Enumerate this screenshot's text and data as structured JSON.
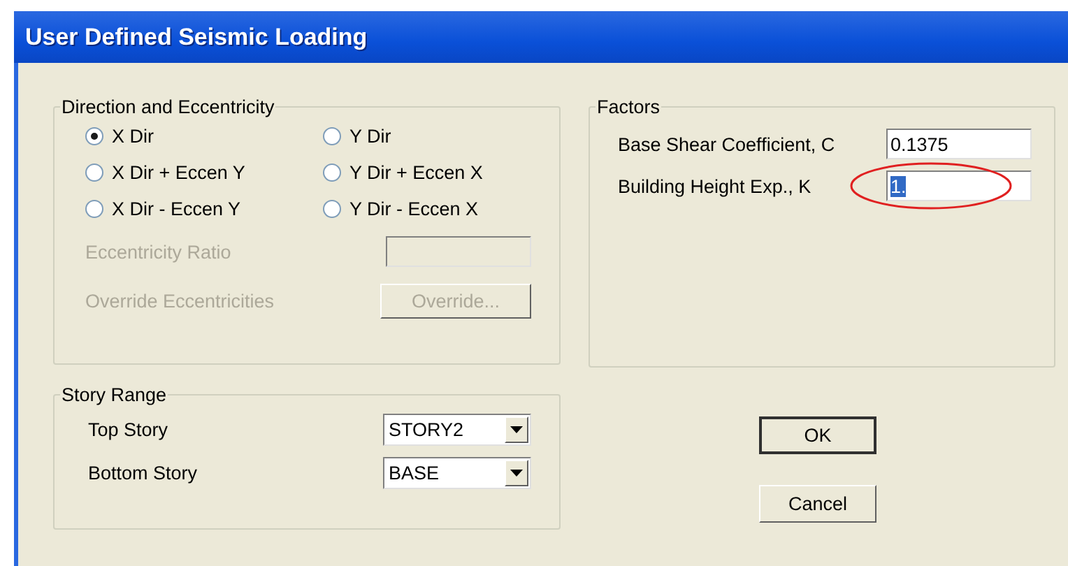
{
  "window": {
    "title": "User Defined Seismic Loading"
  },
  "direction": {
    "title": "Direction and Eccentricity",
    "options": [
      {
        "label": "X Dir",
        "selected": true
      },
      {
        "label": "Y Dir",
        "selected": false
      },
      {
        "label": "X Dir + Eccen Y",
        "selected": false
      },
      {
        "label": "Y Dir + Eccen X",
        "selected": false
      },
      {
        "label": "X Dir - Eccen Y",
        "selected": false
      },
      {
        "label": "Y Dir - Eccen X",
        "selected": false
      }
    ],
    "ratio": {
      "label": "Eccentricity Ratio",
      "disabled": true
    },
    "override": {
      "label": "Override Eccentricities",
      "button": "Override...",
      "disabled": true
    }
  },
  "story_range": {
    "title": "Story Range",
    "fields": [
      {
        "label": "Top Story",
        "value": "STORY2"
      },
      {
        "label": "Bottom Story",
        "value": "BASE"
      }
    ]
  },
  "factors": {
    "title": "Factors",
    "fields": [
      {
        "label": "Base Shear Coefficient, C",
        "value": "0.1375",
        "text_selected": false,
        "circled": false
      },
      {
        "label": "Building Height Exp., K",
        "value": "1.",
        "text_selected": true,
        "circled": true
      }
    ]
  },
  "buttons": [
    {
      "label": "OK",
      "default": true
    },
    {
      "label": "Cancel",
      "default": false
    }
  ]
}
